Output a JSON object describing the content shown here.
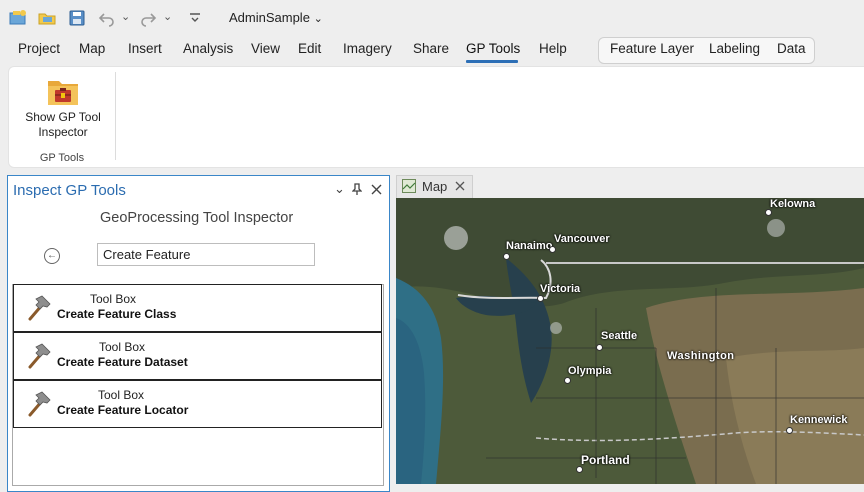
{
  "app": {
    "title": "AdminSample",
    "title_chevron": "⌄"
  },
  "quick_access": {
    "icons": [
      "new-project-icon",
      "open-project-icon",
      "save-project-icon",
      "undo-icon",
      "redo-icon",
      "customize-icon"
    ]
  },
  "menu": {
    "items": [
      "Project",
      "Map",
      "Insert",
      "Analysis",
      "View",
      "Edit",
      "Imagery",
      "Share",
      "GP Tools",
      "Help"
    ],
    "active": "GP Tools",
    "contextual": [
      "Feature Layer",
      "Labeling",
      "Data"
    ]
  },
  "ribbon": {
    "tool_label": "Show GP Tool Inspector",
    "group_label": "GP Tools"
  },
  "pane": {
    "title": "Inspect GP Tools",
    "heading": "GeoProcessing Tool Inspector",
    "search_value": "Create Feature",
    "results": [
      {
        "category": "Tool Box",
        "name": "Create Feature Class"
      },
      {
        "category": "Tool Box",
        "name": "Create Feature Dataset"
      },
      {
        "category": "Tool Box",
        "name": "Create Feature Locator"
      }
    ]
  },
  "map": {
    "tab_label": "Map",
    "cities": [
      "Kelowna",
      "Nanaimo",
      "Vancouver",
      "Victoria",
      "Seattle",
      "Washington",
      "Olympia",
      "Kennewick",
      "Portland"
    ]
  },
  "colors": {
    "accent": "#2b6cb0",
    "pane_border": "#3a86c8",
    "active_underline": "#2d6fb6"
  }
}
